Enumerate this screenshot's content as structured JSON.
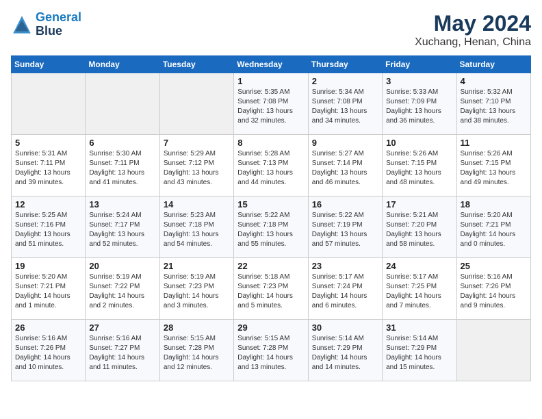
{
  "header": {
    "logo_line1": "General",
    "logo_line2": "Blue",
    "title": "May 2024",
    "location": "Xuchang, Henan, China"
  },
  "days_of_week": [
    "Sunday",
    "Monday",
    "Tuesday",
    "Wednesday",
    "Thursday",
    "Friday",
    "Saturday"
  ],
  "weeks": [
    [
      {
        "day": "",
        "info": ""
      },
      {
        "day": "",
        "info": ""
      },
      {
        "day": "",
        "info": ""
      },
      {
        "day": "1",
        "info": "Sunrise: 5:35 AM\nSunset: 7:08 PM\nDaylight: 13 hours\nand 32 minutes."
      },
      {
        "day": "2",
        "info": "Sunrise: 5:34 AM\nSunset: 7:08 PM\nDaylight: 13 hours\nand 34 minutes."
      },
      {
        "day": "3",
        "info": "Sunrise: 5:33 AM\nSunset: 7:09 PM\nDaylight: 13 hours\nand 36 minutes."
      },
      {
        "day": "4",
        "info": "Sunrise: 5:32 AM\nSunset: 7:10 PM\nDaylight: 13 hours\nand 38 minutes."
      }
    ],
    [
      {
        "day": "5",
        "info": "Sunrise: 5:31 AM\nSunset: 7:11 PM\nDaylight: 13 hours\nand 39 minutes."
      },
      {
        "day": "6",
        "info": "Sunrise: 5:30 AM\nSunset: 7:11 PM\nDaylight: 13 hours\nand 41 minutes."
      },
      {
        "day": "7",
        "info": "Sunrise: 5:29 AM\nSunset: 7:12 PM\nDaylight: 13 hours\nand 43 minutes."
      },
      {
        "day": "8",
        "info": "Sunrise: 5:28 AM\nSunset: 7:13 PM\nDaylight: 13 hours\nand 44 minutes."
      },
      {
        "day": "9",
        "info": "Sunrise: 5:27 AM\nSunset: 7:14 PM\nDaylight: 13 hours\nand 46 minutes."
      },
      {
        "day": "10",
        "info": "Sunrise: 5:26 AM\nSunset: 7:15 PM\nDaylight: 13 hours\nand 48 minutes."
      },
      {
        "day": "11",
        "info": "Sunrise: 5:26 AM\nSunset: 7:15 PM\nDaylight: 13 hours\nand 49 minutes."
      }
    ],
    [
      {
        "day": "12",
        "info": "Sunrise: 5:25 AM\nSunset: 7:16 PM\nDaylight: 13 hours\nand 51 minutes."
      },
      {
        "day": "13",
        "info": "Sunrise: 5:24 AM\nSunset: 7:17 PM\nDaylight: 13 hours\nand 52 minutes."
      },
      {
        "day": "14",
        "info": "Sunrise: 5:23 AM\nSunset: 7:18 PM\nDaylight: 13 hours\nand 54 minutes."
      },
      {
        "day": "15",
        "info": "Sunrise: 5:22 AM\nSunset: 7:18 PM\nDaylight: 13 hours\nand 55 minutes."
      },
      {
        "day": "16",
        "info": "Sunrise: 5:22 AM\nSunset: 7:19 PM\nDaylight: 13 hours\nand 57 minutes."
      },
      {
        "day": "17",
        "info": "Sunrise: 5:21 AM\nSunset: 7:20 PM\nDaylight: 13 hours\nand 58 minutes."
      },
      {
        "day": "18",
        "info": "Sunrise: 5:20 AM\nSunset: 7:21 PM\nDaylight: 14 hours\nand 0 minutes."
      }
    ],
    [
      {
        "day": "19",
        "info": "Sunrise: 5:20 AM\nSunset: 7:21 PM\nDaylight: 14 hours\nand 1 minute."
      },
      {
        "day": "20",
        "info": "Sunrise: 5:19 AM\nSunset: 7:22 PM\nDaylight: 14 hours\nand 2 minutes."
      },
      {
        "day": "21",
        "info": "Sunrise: 5:19 AM\nSunset: 7:23 PM\nDaylight: 14 hours\nand 3 minutes."
      },
      {
        "day": "22",
        "info": "Sunrise: 5:18 AM\nSunset: 7:23 PM\nDaylight: 14 hours\nand 5 minutes."
      },
      {
        "day": "23",
        "info": "Sunrise: 5:17 AM\nSunset: 7:24 PM\nDaylight: 14 hours\nand 6 minutes."
      },
      {
        "day": "24",
        "info": "Sunrise: 5:17 AM\nSunset: 7:25 PM\nDaylight: 14 hours\nand 7 minutes."
      },
      {
        "day": "25",
        "info": "Sunrise: 5:16 AM\nSunset: 7:26 PM\nDaylight: 14 hours\nand 9 minutes."
      }
    ],
    [
      {
        "day": "26",
        "info": "Sunrise: 5:16 AM\nSunset: 7:26 PM\nDaylight: 14 hours\nand 10 minutes."
      },
      {
        "day": "27",
        "info": "Sunrise: 5:16 AM\nSunset: 7:27 PM\nDaylight: 14 hours\nand 11 minutes."
      },
      {
        "day": "28",
        "info": "Sunrise: 5:15 AM\nSunset: 7:28 PM\nDaylight: 14 hours\nand 12 minutes."
      },
      {
        "day": "29",
        "info": "Sunrise: 5:15 AM\nSunset: 7:28 PM\nDaylight: 14 hours\nand 13 minutes."
      },
      {
        "day": "30",
        "info": "Sunrise: 5:14 AM\nSunset: 7:29 PM\nDaylight: 14 hours\nand 14 minutes."
      },
      {
        "day": "31",
        "info": "Sunrise: 5:14 AM\nSunset: 7:29 PM\nDaylight: 14 hours\nand 15 minutes."
      },
      {
        "day": "",
        "info": ""
      }
    ]
  ]
}
